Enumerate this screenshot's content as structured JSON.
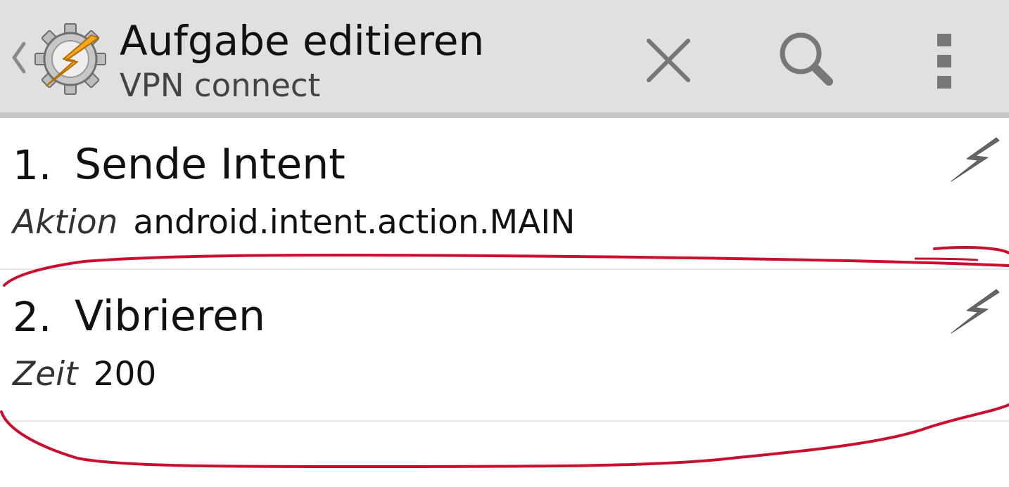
{
  "header": {
    "title": "Aufgabe editieren",
    "subtitle": "VPN connect",
    "icons": {
      "up": "chevron-left-icon",
      "logo": "tasker-gear-bolt-logo",
      "close": "close-icon",
      "search": "search-icon",
      "overflow": "more-vert-icon"
    }
  },
  "actions": [
    {
      "number": "1.",
      "name": "Sende Intent",
      "param_label": "Aktion",
      "param_value": "android.intent.action.MAIN",
      "icon": "lightning-bolt-icon"
    },
    {
      "number": "2.",
      "name": "Vibrieren",
      "param_label": "Zeit",
      "param_value": "200",
      "icon": "lightning-bolt-icon"
    }
  ],
  "colors": {
    "actionbar_bg": "#e0e0e0",
    "accent_orange": "#f5a623",
    "annotation_red": "#c8102e"
  }
}
